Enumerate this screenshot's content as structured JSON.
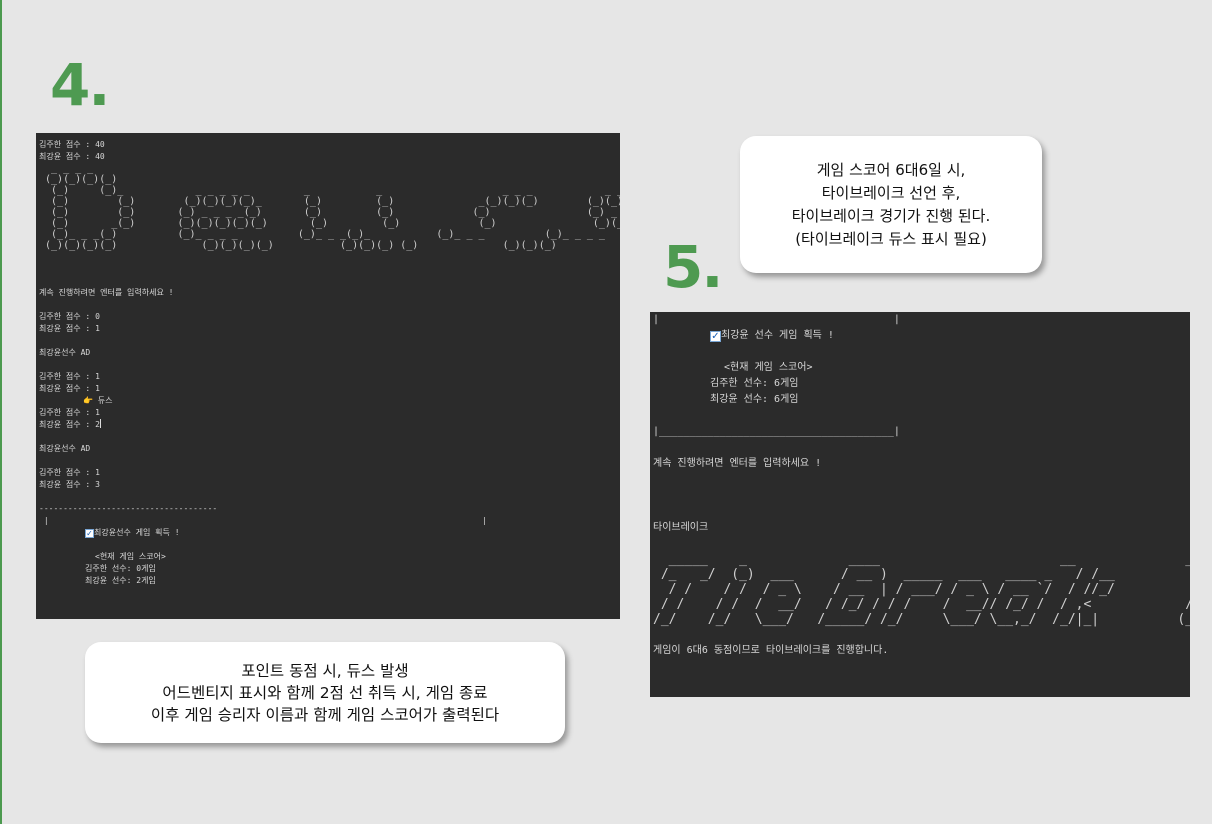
{
  "step_4": {
    "number": "4.",
    "console_lines": [
      "김주한 점수 : 40",
      "최강윤 점수 : 40"
    ],
    "ascii_banner": "  _ _ _ _\n (_)(_)(_)(_)\n  (_)     (_)_            _ _ _ _ _         _           _                    _ _ _            _ _ _ _ _\n  (_)        (_)        (_)(_)(_)(_)_       (_)         (_)              _(_)(_)(_)        (_)(_)(_)(_)_\n  (_)        (_)       (_) _ _ _ _(_)       (_)         (_)             (_)                (_) _ _ _ _(_)\n  (_)       _(_)       (_)(_)(_)(_)(_)       (_)         (_)             (_)                (_)(_)(_)(_)(_)\n  (_)_ _ _(_)          (_)_ _ _ _          (_)_ _ _(_)_           (_)_ _ _          (_)_ _ _ _\n (_)(_)(_)(_)              (_)(_)(_)(_)           (_)(_)(_) (_)              (_)(_)(_)            (_)(_)(_)(_)",
    "prompt_enter": "계속 진행하려면 엔터를 입력하세요 !",
    "score_block_1": [
      "김주한 점수 : 0",
      "최강윤 점수 : 1"
    ],
    "advantage_1": "최강윤선수 AD",
    "score_block_2": [
      "김주한 점수 : 1",
      "최강윤 점수 : 1"
    ],
    "deuce_label": "👉 듀스",
    "score_block_3": [
      "김주한 점수 : 1",
      "최강윤 점수 : 2"
    ],
    "advantage_2": "최강윤선수 AD",
    "score_block_4": [
      "김주한 점수 : 1",
      "최강윤 점수 : 3"
    ],
    "box_top": "-------------------------------------",
    "game_won": "최강윤선수 게임 획득 !",
    "current_score_title": "<현재 게임 스코어>",
    "current_score_lines": [
      "김주한 선수: 0게임",
      "최강윤 선수: 2게임"
    ],
    "caption": [
      "포인트 동점 시, 듀스 발생",
      "어드벤티지 표시와 함께 2점 선 취득 시, 게임 종료",
      "이후 게임 승리자 이름과 함께 게임 스코어가 출력된다"
    ]
  },
  "step_5": {
    "number": "5.",
    "game_won": "최강윤 선수 게임 획득 !",
    "current_score_title": "<현재 게임 스코어>",
    "current_score_lines": [
      "김주한 선수: 6게임",
      "최강윤 선수: 6게임"
    ],
    "prompt_enter": "계속 진행하려면 엔터를 입력하세요 !",
    "tiebreak_title": "타이브레이크",
    "ascii_banner": "  _____    _             ____                       __              __\n /_   _/  (_)  ___      / __ )  _____  ___   ____ _   / /__           / /\n  / /    / /  / _ \\    / __  | / ___/ / _ \\ / __ `/  / //_/          / /\n / /    / /  /  __/   / /_/ / / /    /  __// /_/ /  / ,<            /_/\n/_/    /_/   \\___/   /_____/ /_/     \\___/ \\__,_/  /_/|_|          (_)",
    "final_message": "게임이 6대6 동점이므로 타이브레이크를 진행합니다.",
    "caption": [
      "게임 스코어 6대6일 시,",
      "타이브레이크 선언 후,",
      "타이브레이크 경기가 진행 된다.",
      "(타이브레이크 듀스 표시 필요)"
    ]
  }
}
